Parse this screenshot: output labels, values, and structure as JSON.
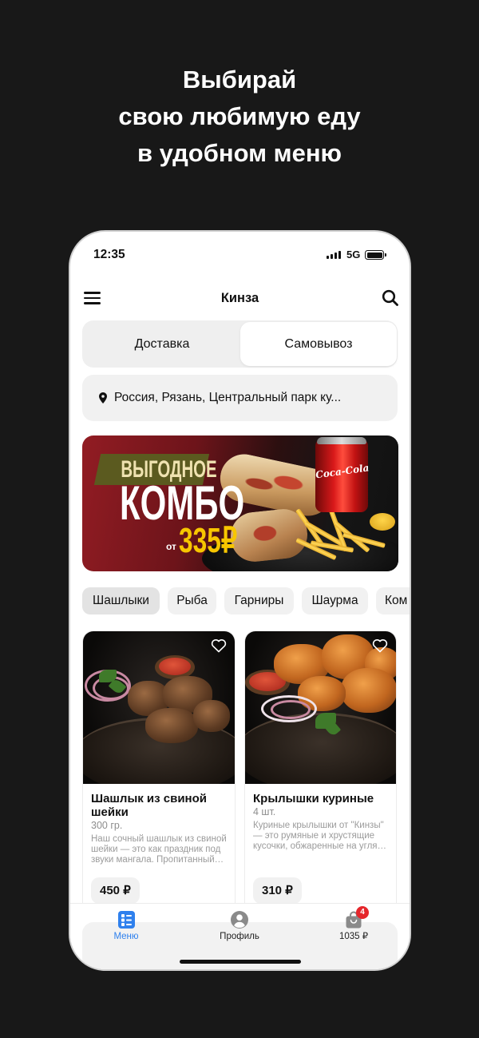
{
  "promo": {
    "lines": [
      "Выбирай",
      "свою любимую еду",
      "в удобном меню"
    ]
  },
  "status_bar": {
    "time": "12:35",
    "network": "5G",
    "icons": [
      "signal-icon",
      "battery-icon"
    ]
  },
  "header": {
    "title": "Кинза",
    "menu_icon": "hamburger-icon",
    "search_icon": "search-icon"
  },
  "delivery_mode": {
    "options": [
      "Доставка",
      "Самовывоз"
    ],
    "selected_index": 1
  },
  "address": {
    "icon": "location-pin-icon",
    "text": "Россия, Рязань, Центральный парк ку..."
  },
  "banner": {
    "tag": "ВЫГОДНОЕ",
    "title": "КОМБО",
    "price_prefix": "от",
    "price": "335₽",
    "can_logo": "Coca-Cola"
  },
  "categories": {
    "items": [
      "Шашлыки",
      "Рыба",
      "Гарниры",
      "Шаурма",
      "Ком"
    ],
    "selected_index": 0
  },
  "products": [
    {
      "title": "Шашлык из свиной шейки",
      "weight": "300 гр.",
      "description_lines": [
        "Наш сочный шашлык из свиной",
        "шейки — это как праздник под",
        "звуки мангала. Пропитанный…"
      ],
      "price": "450 ₽",
      "favorite_icon": "heart-outline-icon"
    },
    {
      "title": "Крылышки куриные",
      "weight": "4 шт.",
      "description_lines": [
        "Куриные крылышки от \"Кинзы\"",
        "— это румяные и хрустящие",
        "кусочки, обжаренные на угля…"
      ],
      "price": "310 ₽",
      "favorite_icon": "heart-outline-icon"
    }
  ],
  "bottom_nav": {
    "active_index": 0,
    "items": [
      {
        "label": "Меню",
        "icon": "menu-list-icon"
      },
      {
        "label": "Профиль",
        "icon": "profile-icon"
      },
      {
        "label": "1035 ₽",
        "icon": "cart-icon",
        "badge": "4"
      }
    ]
  },
  "colors": {
    "background": "#181818",
    "accent": "#2f80ed",
    "banner_price": "#f7c600",
    "badge": "#e5262b"
  }
}
